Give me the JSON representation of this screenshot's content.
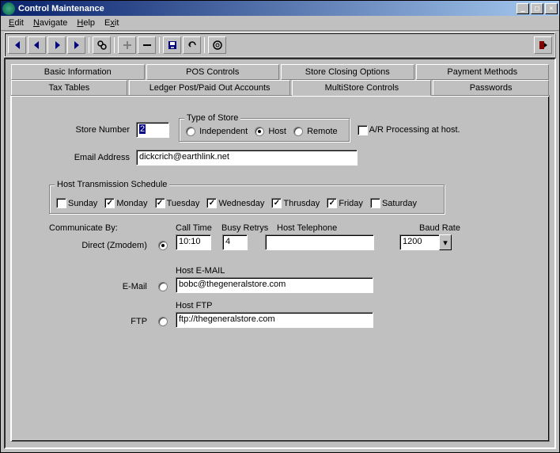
{
  "title": "Control Maintenance",
  "menu": {
    "edit": "Edit",
    "navigate": "Navigate",
    "help": "Help",
    "exit": "Exit"
  },
  "tabs_row1": {
    "basic": "Basic Information",
    "pos": "POS Controls",
    "closing": "Store Closing Options",
    "payment": "Payment Methods"
  },
  "tabs_row2": {
    "tax": "Tax Tables",
    "ledger": "Ledger Post/Paid Out Accounts",
    "multi": "MultiStore Controls",
    "passwords": "Passwords"
  },
  "form": {
    "store_number_label": "Store Number",
    "store_number_value": "2",
    "type_of_store_legend": "Type of Store",
    "independent": "Independent",
    "host": "Host",
    "remote": "Remote",
    "ar_label": "A/R Processing at host.",
    "email_label": "Email Address",
    "email_value": "dickcrich@earthlink.net",
    "schedule_legend": "Host Transmission Schedule",
    "days": {
      "sun": "Sunday",
      "mon": "Monday",
      "tue": "Tuesday",
      "wed": "Wednesday",
      "thu": "Thrusday",
      "fri": "Friday",
      "sat": "Saturday"
    },
    "communicate_by": "Communicate By:",
    "direct": "Direct (Zmodem)",
    "call_time_label": "Call Time",
    "call_time_value": "10:10",
    "busy_label": "Busy Retrys",
    "busy_value": "4",
    "host_tel_label": "Host Telephone",
    "host_tel_value": "",
    "baud_label": "Baud Rate",
    "baud_value": "1200",
    "email_comm": "E-Mail",
    "host_email_label": "Host E-MAIL",
    "host_email_value": "bobc@thegeneralstore.com",
    "ftp_comm": "FTP",
    "host_ftp_label": "Host FTP",
    "host_ftp_value": "ftp://thegeneralstore.com"
  }
}
